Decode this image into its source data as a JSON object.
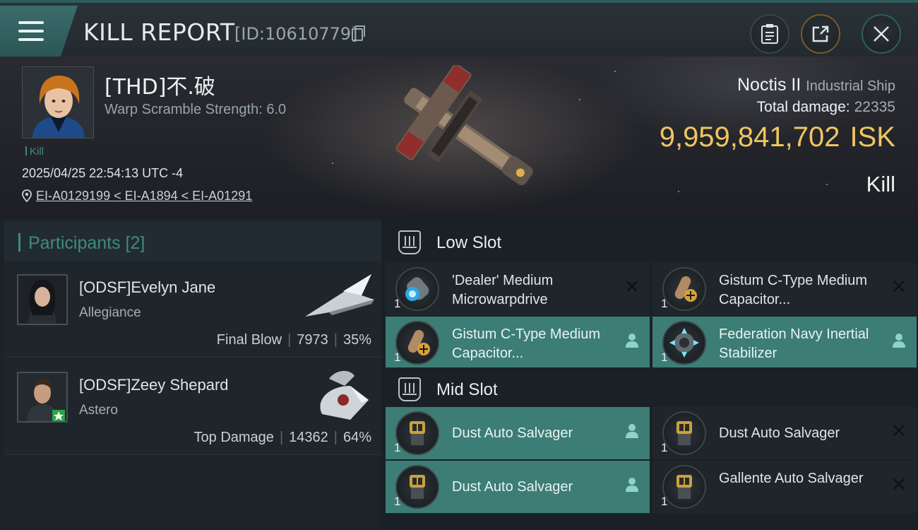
{
  "header": {
    "title": "KILL REPORT",
    "report_id": "[ID:10610779]"
  },
  "victim": {
    "name": "[THD]不.破",
    "warp_scramble": "Warp Scramble Strength: 6.0",
    "kill_tag": "Kill",
    "datetime": "2025/04/25 22:54:13 UTC -4",
    "location": "EI-A0129199 < EI-A1894 < EI-A01291"
  },
  "ship": {
    "name": "Noctis II",
    "class": "Industrial Ship",
    "total_damage_label": "Total damage:",
    "total_damage_value": "22335",
    "isk_value": "9,959,841,702",
    "isk_unit": "ISK",
    "outcome": "Kill"
  },
  "participants": {
    "header": "Participants [2]",
    "rows": [
      {
        "name": "[ODSF]Evelyn Jane",
        "ship": "Allegiance",
        "role": "Final Blow",
        "damage": "7973",
        "percent": "35%"
      },
      {
        "name": "[ODSF]Zeey Shepard",
        "ship": "Astero",
        "role": "Top Damage",
        "damage": "14362",
        "percent": "64%"
      }
    ]
  },
  "low_slot": {
    "label": "Low Slot",
    "items": [
      {
        "name": "'Dealer' Medium Microwarpdrive",
        "qty": "1",
        "state": "destroyed",
        "icon": "microwarpdrive-icon"
      },
      {
        "name": "Gistum C-Type Medium Capacitor...",
        "qty": "1",
        "state": "destroyed",
        "icon": "capacitor-icon"
      },
      {
        "name": "Gistum C-Type Medium Capacitor...",
        "qty": "1",
        "state": "dropped",
        "icon": "capacitor-icon"
      },
      {
        "name": "Federation Navy Inertial Stabilizer",
        "qty": "1",
        "state": "dropped",
        "icon": "stabilizer-icon"
      }
    ]
  },
  "mid_slot": {
    "label": "Mid Slot",
    "items": [
      {
        "name": "Dust Auto Salvager",
        "qty": "1",
        "state": "dropped",
        "icon": "salvager-icon"
      },
      {
        "name": "Dust Auto Salvager",
        "qty": "1",
        "state": "destroyed",
        "icon": "salvager-icon"
      },
      {
        "name": "Dust Auto Salvager",
        "qty": "1",
        "state": "dropped",
        "icon": "salvager-icon"
      },
      {
        "name": "Gallente Auto Salvager",
        "qty": "1",
        "state": "destroyed",
        "icon": "salvager-icon"
      }
    ]
  },
  "colors": {
    "accent_teal": "#3c7d76",
    "isk_gold": "#f0c561",
    "participants_header": "#3e8a84"
  }
}
